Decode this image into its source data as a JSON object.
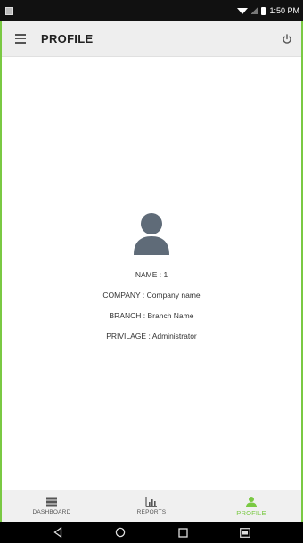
{
  "status_bar": {
    "time": "1:50 PM"
  },
  "app_bar": {
    "title": "PROFILE"
  },
  "profile": {
    "name_line": "NAME : 1",
    "company_line": "COMPANY : Company name",
    "branch_line": "BRANCH : Branch Name",
    "privilege_line": "PRIVILAGE : Administrator"
  },
  "bottom_nav": {
    "items": [
      {
        "label": "DASHBOARD",
        "icon": "dashboard-icon"
      },
      {
        "label": "REPORTS",
        "icon": "reports-icon"
      },
      {
        "label": "PROFILE",
        "icon": "person-icon"
      }
    ],
    "active_index": 2
  },
  "colors": {
    "accent": "#7ac943",
    "avatar": "#5f6b78",
    "app_bar": "#eeeeee"
  }
}
